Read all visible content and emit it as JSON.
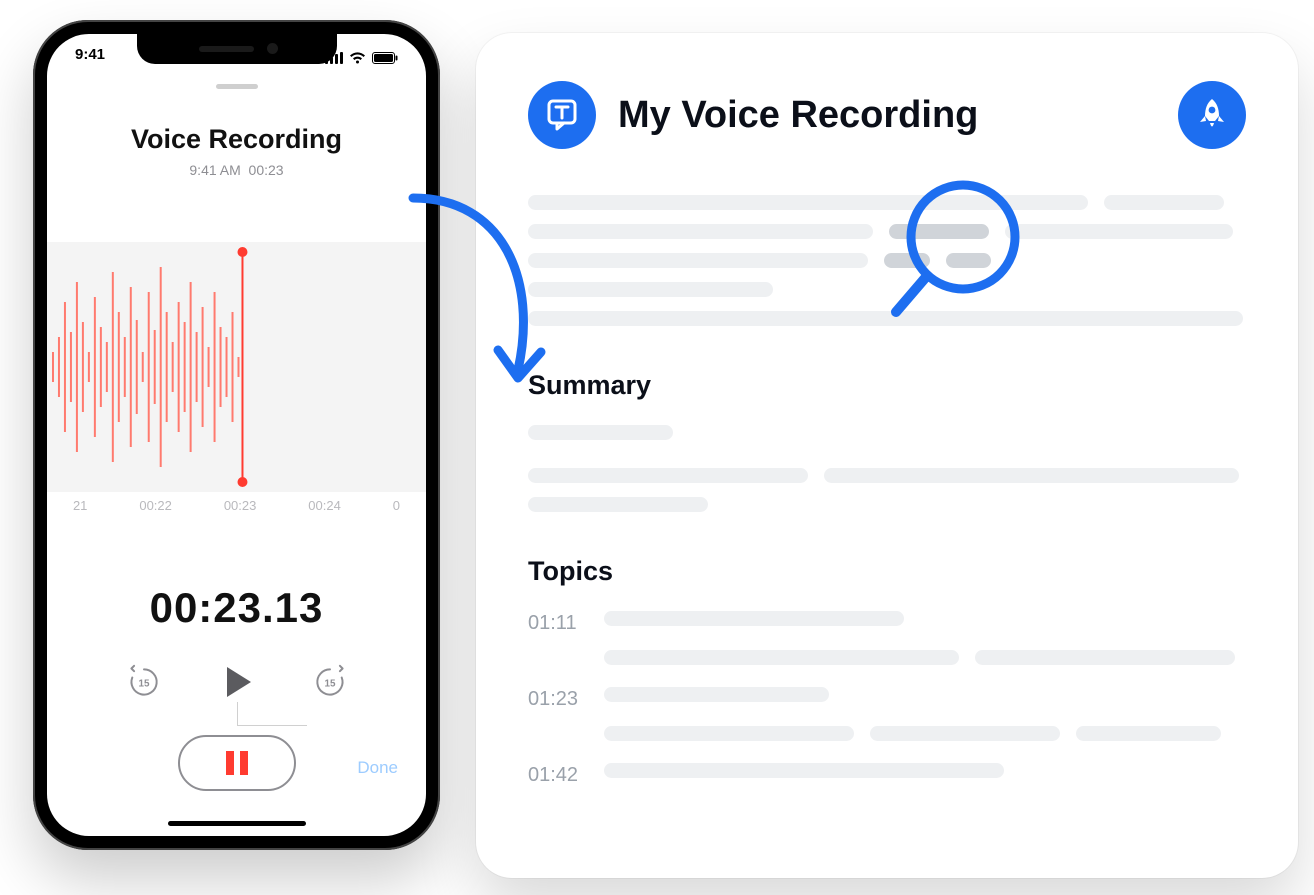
{
  "phone": {
    "status_time": "9:41",
    "title": "Voice Recording",
    "subtitle_time": "9:41 AM",
    "subtitle_dur": "00:23",
    "ticks": [
      "21",
      "00:22",
      "00:23",
      "00:24",
      "0"
    ],
    "elapsed": "00:23.13",
    "skip_amount": "15",
    "done_label": "Done"
  },
  "card": {
    "title": "My Voice Recording",
    "summary_heading": "Summary",
    "topics_heading": "Topics",
    "topics": [
      {
        "time": "01:11"
      },
      {
        "time": "01:23"
      },
      {
        "time": "01:42"
      }
    ]
  },
  "colors": {
    "accent": "#1d6ef0",
    "waveform": "#ff8a80",
    "record_red": "#ff3b30"
  }
}
